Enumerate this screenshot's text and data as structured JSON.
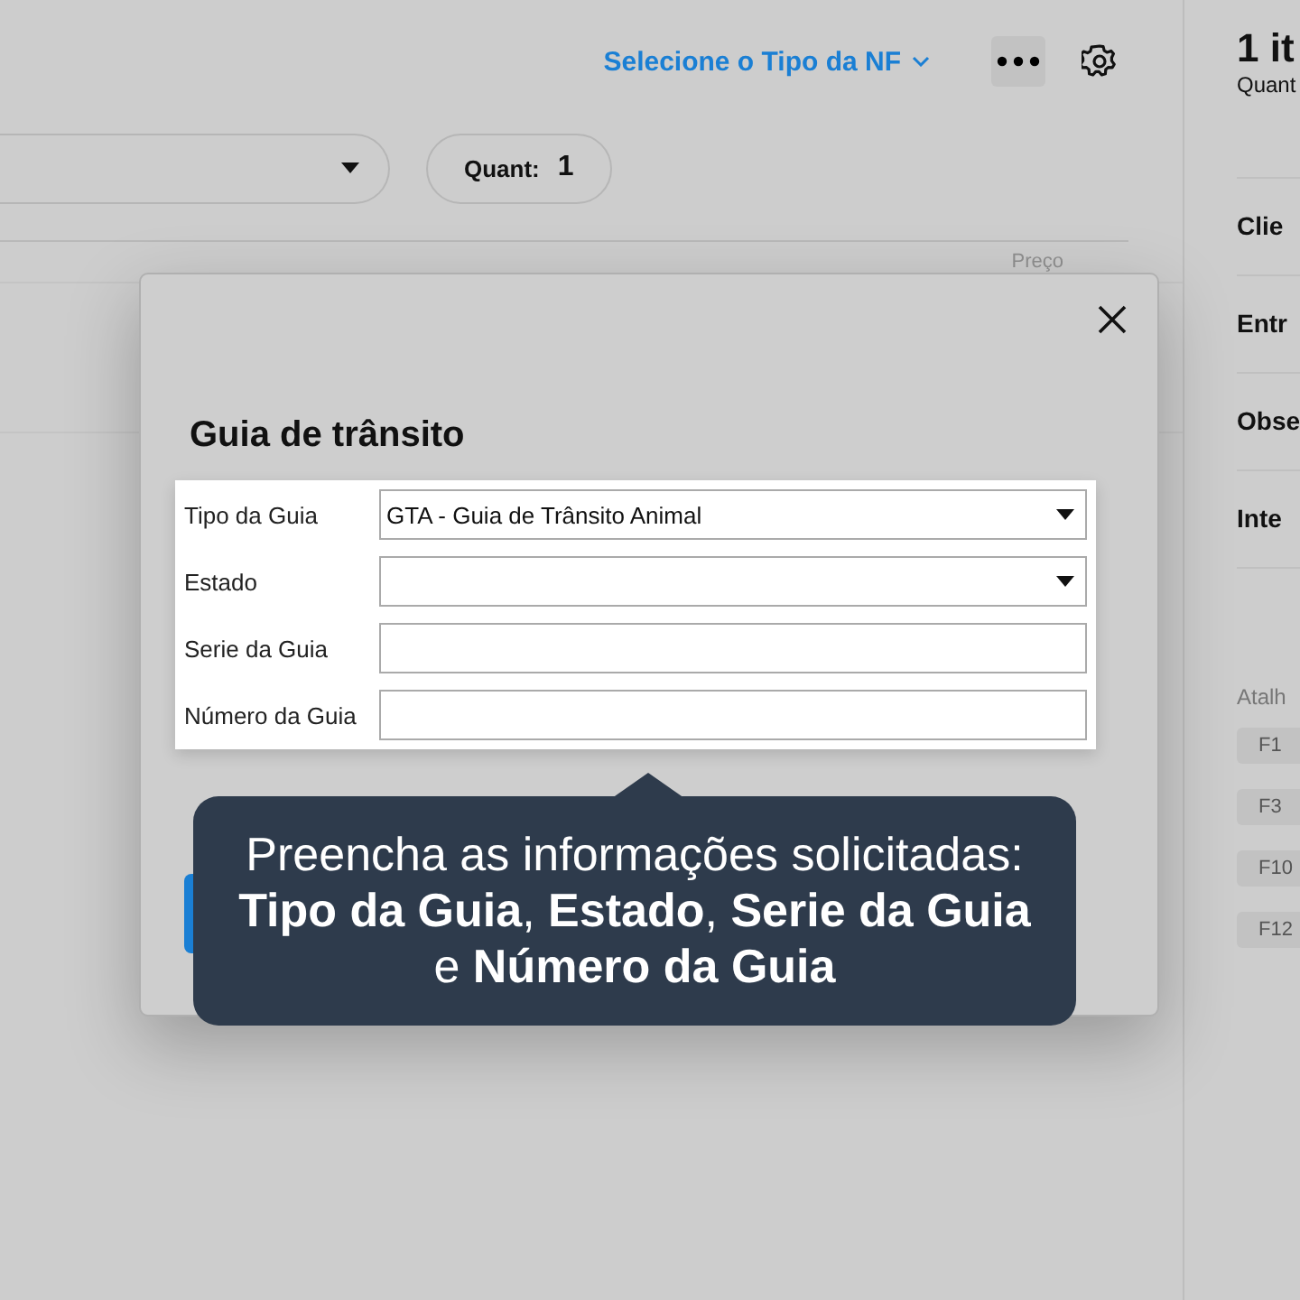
{
  "header": {
    "nf_type_link": "Selecione o Tipo da NF"
  },
  "quantity": {
    "label": "Quant:",
    "value": "1"
  },
  "table": {
    "columns": [
      "Preço"
    ]
  },
  "summary": {
    "title": "1 it",
    "subtitle": "Quant"
  },
  "sections": [
    "Clie",
    "Entr",
    "Obse",
    "Inte"
  ],
  "shortcuts": {
    "title": "Atalh",
    "keys": [
      "F1",
      "F3",
      "F10",
      "F12"
    ]
  },
  "dialog": {
    "title": "Guia de trânsito",
    "fields": [
      {
        "label": "Tipo da Guia",
        "kind": "select",
        "value": "GTA - Guia de Trânsito Animal"
      },
      {
        "label": "Estado",
        "kind": "select"
      },
      {
        "label": "Serie da Guia",
        "kind": "text"
      },
      {
        "label": "Número da Guia",
        "kind": "text"
      }
    ]
  },
  "tooltip": {
    "text": "Preencha as informações solicitadas: **Tipo da Guia**, **Estado**, **Serie da Guia** e **Número da Guia**"
  }
}
